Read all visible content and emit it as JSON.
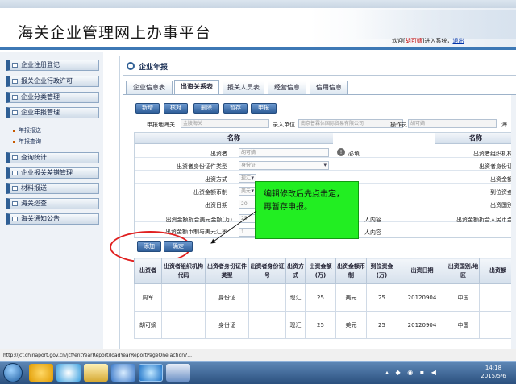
{
  "header": {
    "title": "海关企业管理网上办事平台",
    "welcome_prefix": "欢迎[",
    "welcome_user": "胡可嫡",
    "welcome_suffix": "]进入系统，",
    "logout": "退出"
  },
  "sidebar": {
    "items": [
      {
        "label": "企业注册登记"
      },
      {
        "label": "报关企业行政许可"
      },
      {
        "label": "企业分类管理"
      },
      {
        "label": "企业年报管理"
      },
      {
        "label": "查询统计"
      },
      {
        "label": "企业报关差错管理"
      },
      {
        "label": "材料报送"
      },
      {
        "label": "海关巡查"
      },
      {
        "label": "海关通知公告"
      }
    ],
    "subitems": [
      {
        "label": "年报报送"
      },
      {
        "label": "年报查询"
      }
    ]
  },
  "section": {
    "title": "企业年报"
  },
  "tabs": [
    {
      "label": "企业信息表"
    },
    {
      "label": "出资关系表"
    },
    {
      "label": "报关人员表"
    },
    {
      "label": "经营信息"
    },
    {
      "label": "信用信息"
    }
  ],
  "toolbar": {
    "new": "新增",
    "approve": "核对",
    "delete": "删除",
    "save": "暂存",
    "submit": "申报"
  },
  "filters": {
    "customs_label": "申报地海关",
    "customs_value": "金陵海关",
    "unit_label": "录入单位",
    "unit_value": "南京普霖体国际贸易有限公司",
    "operator_label": "操作员",
    "operator_value": "胡可嫡",
    "extra_label": "海"
  },
  "form": {
    "col_name": "名称",
    "col_name2": "名称",
    "investor_label": "出资者",
    "investor_value": "胡可嫡",
    "required_label": "必填",
    "idtype_label": "出资者身份证件类型",
    "idtype_value": "身份证",
    "method_label": "出资方式",
    "method_value": "现汇",
    "currency_label": "出资金额币制",
    "currency_value": "美元",
    "date_label": "出资日期",
    "date_value": "20",
    "usd_label": "出资金额折合美元金额(万)",
    "usd_value": "25",
    "rate_label": "出资金额币制与美元汇率",
    "rate_value": "1",
    "r_org_label": "出资者组织机构",
    "r_id_label": "出资者身份证",
    "r_amount_label": "出资金额",
    "r_arrival_label": "到位资金",
    "r_country_label": "出资国别",
    "r_rmb_label": "出资金额折合人民币金",
    "mid1": "人内容",
    "mid2": "人内容"
  },
  "hint": {
    "text": "编辑修改后先点击定，再暂存申报。"
  },
  "actions": {
    "add": "添加",
    "confirm": "确定"
  },
  "grid": {
    "headers": [
      "出资者",
      "出资者组织机构代码",
      "出资者身份证件类型",
      "出资者身份证号",
      "出资方式",
      "出资金额(万)",
      "出资金额币制",
      "到位资金(万)",
      "出资日期",
      "出资国别/地区",
      "出资额"
    ],
    "rows": [
      [
        "周军",
        "",
        "身份证",
        "",
        "现汇",
        "25",
        "美元",
        "25",
        "20120904",
        "中国",
        ""
      ],
      [
        "胡可嫡",
        "",
        "身份证",
        "",
        "现汇",
        "25",
        "美元",
        "25",
        "20120904",
        "中国",
        ""
      ]
    ]
  },
  "status": {
    "url": "http://jcf.chinaport.gov.cn/jcf/entYearReport/loadYearReportPageOne.action?..."
  },
  "clock": {
    "time": "14:18",
    "date": "2015/5/6"
  },
  "colors": {
    "accent": "#3d78b5",
    "button": "#2f5f9a",
    "hint_bg": "#22ee22",
    "ellipse": "#e02020"
  }
}
